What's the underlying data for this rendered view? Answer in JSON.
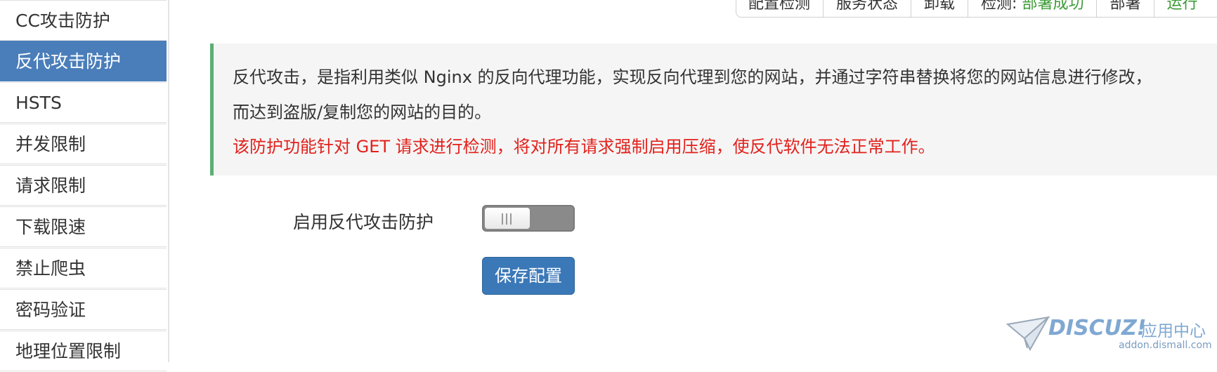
{
  "sidebar": {
    "items": [
      {
        "label": "CC攻击防护",
        "active": false
      },
      {
        "label": "反代攻击防护",
        "active": true
      },
      {
        "label": "HSTS",
        "active": false
      },
      {
        "label": "并发限制",
        "active": false
      },
      {
        "label": "请求限制",
        "active": false
      },
      {
        "label": "下载限速",
        "active": false
      },
      {
        "label": "禁止爬虫",
        "active": false
      },
      {
        "label": "密码验证",
        "active": false
      },
      {
        "label": "地理位置限制",
        "active": false
      }
    ]
  },
  "top_tabs": {
    "config_check": "配置检测",
    "service_status": "服务状态",
    "uninstall": "卸载",
    "detect_label": "检测:",
    "detect_status": "部署成功",
    "deploy": "部署",
    "run": "运行"
  },
  "notice": {
    "line1": "反代攻击，是指利用类似 Nginx 的反向代理功能，实现反向代理到您的网站，并通过字符串替换将您的网站信息进行修改，",
    "line2": "而达到盗版/复制您的网站的目的。",
    "warning": "该防护功能针对 GET 请求进行检测，将对所有请求强制启用压缩，使反代软件无法正常工作。"
  },
  "form": {
    "enable_label": "启用反代攻击防护",
    "enable_on": false,
    "save_label": "保存配置"
  },
  "watermark": {
    "brand": "DISCUZ!",
    "brand_cn": "应用中心",
    "domain": "addon.dismall.com"
  },
  "colors": {
    "accent": "#4a7eba",
    "success": "#3c9b36",
    "warning": "#e2211c",
    "notice_border": "#5cae73"
  }
}
